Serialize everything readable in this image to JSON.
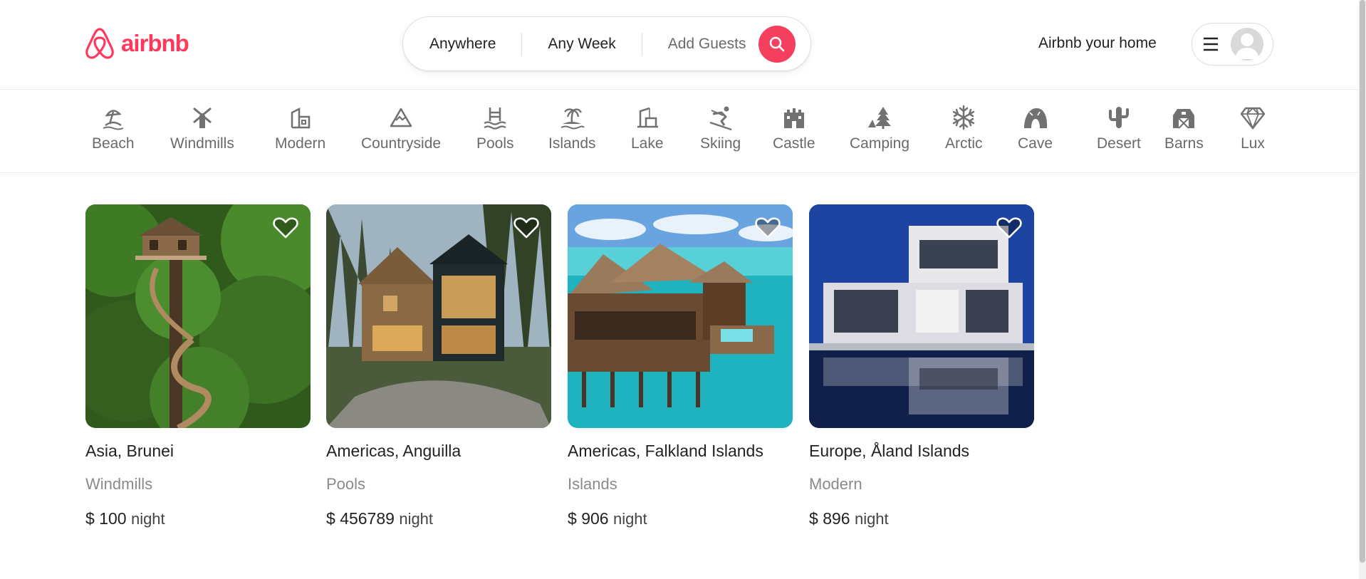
{
  "brand": {
    "name": "airbnb",
    "color": "#ff385c"
  },
  "search": {
    "location": "Anywhere",
    "week": "Any Week",
    "guests": "Add Guests",
    "icon": "search-icon"
  },
  "header": {
    "host_link": "Airbnb your home",
    "menu_icon": "hamburger-menu-icon",
    "avatar_icon": "user-avatar-icon"
  },
  "categories": [
    {
      "label": "Beach",
      "icon": "beach-icon"
    },
    {
      "label": "Windmills",
      "icon": "windmill-icon"
    },
    {
      "label": "Modern",
      "icon": "modern-house-icon"
    },
    {
      "label": "Countryside",
      "icon": "mountain-icon"
    },
    {
      "label": "Pools",
      "icon": "pool-icon"
    },
    {
      "label": "Islands",
      "icon": "island-icon"
    },
    {
      "label": "Lake",
      "icon": "lake-icon"
    },
    {
      "label": "Skiing",
      "icon": "skiing-icon"
    },
    {
      "label": "Castle",
      "icon": "castle-icon"
    },
    {
      "label": "Camping",
      "icon": "camping-icon"
    },
    {
      "label": "Arctic",
      "icon": "snowflake-icon"
    },
    {
      "label": "Cave",
      "icon": "cave-icon"
    },
    {
      "label": "Desert",
      "icon": "cactus-icon"
    },
    {
      "label": "Barns",
      "icon": "barn-icon"
    },
    {
      "label": "Lux",
      "icon": "diamond-icon"
    }
  ],
  "listings": [
    {
      "location": "Asia, Brunei",
      "category": "Windmills",
      "currency": "$",
      "price": "100",
      "unit": "night"
    },
    {
      "location": "Americas, Anguilla",
      "category": "Pools",
      "currency": "$",
      "price": "456789",
      "unit": "night"
    },
    {
      "location": "Americas, Falkland Islands",
      "category": "Islands",
      "currency": "$",
      "price": "906",
      "unit": "night"
    },
    {
      "location": "Europe, Åland Islands",
      "category": "Modern",
      "currency": "$",
      "price": "896",
      "unit": "night"
    }
  ]
}
